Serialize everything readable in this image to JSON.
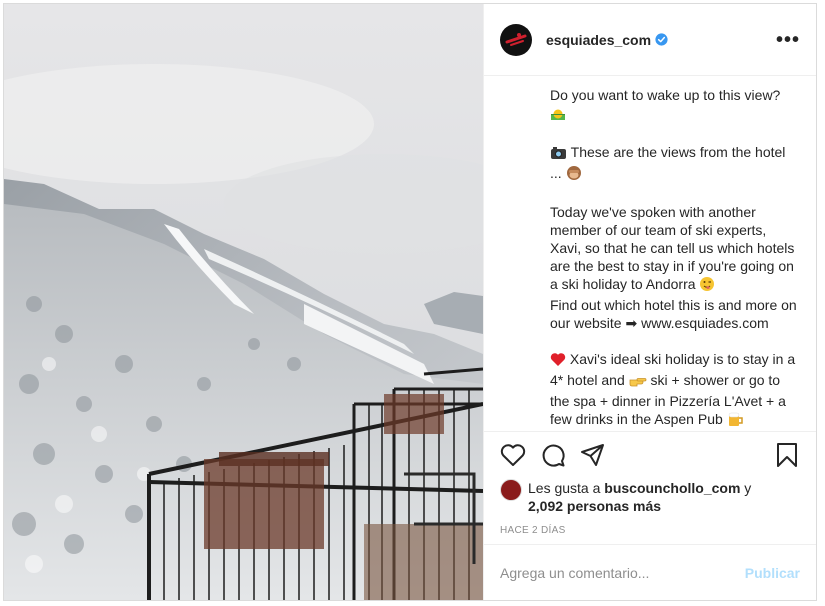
{
  "header": {
    "username": "esquiades_com",
    "verified_icon": "verified-badge-icon",
    "more_icon": "more-options-icon",
    "more_label": "•••"
  },
  "caption": {
    "p1": "Do you want to wake up to this view?",
    "p2": "These are the views from the hotel ...",
    "p3": "Today we've spoken with another member of our team of ski experts, Xavi, so that he can tell us which hotels are the best to stay in if you're going on a ski holiday to Andorra",
    "p4": "Find out which hotel this is and more on our website ➡ www.esquiades.com",
    "p5a": "Xavi's ideal ski holiday is to stay in a 4* hotel and",
    "p5b": "ski + shower or go to the spa + dinner in Pizzería L'Avet + a few drinks in the Aspen Pub"
  },
  "actions": {
    "like_icon": "heart-icon",
    "comment_icon": "comment-icon",
    "share_icon": "share-icon",
    "save_icon": "bookmark-icon"
  },
  "likes": {
    "prefix": "Les gusta a ",
    "user": "buscounchollo_com",
    "middle": " y ",
    "others": "2,092 personas más"
  },
  "timestamp": "HACE 2 DÍAS",
  "comment": {
    "placeholder": "Agrega un comentario...",
    "publish_label": "Publicar"
  },
  "colors": {
    "verified": "#3897f0",
    "publish_disabled": "#b2dffc",
    "avatar_bg": "#111111",
    "logo_red": "#d0202e"
  }
}
